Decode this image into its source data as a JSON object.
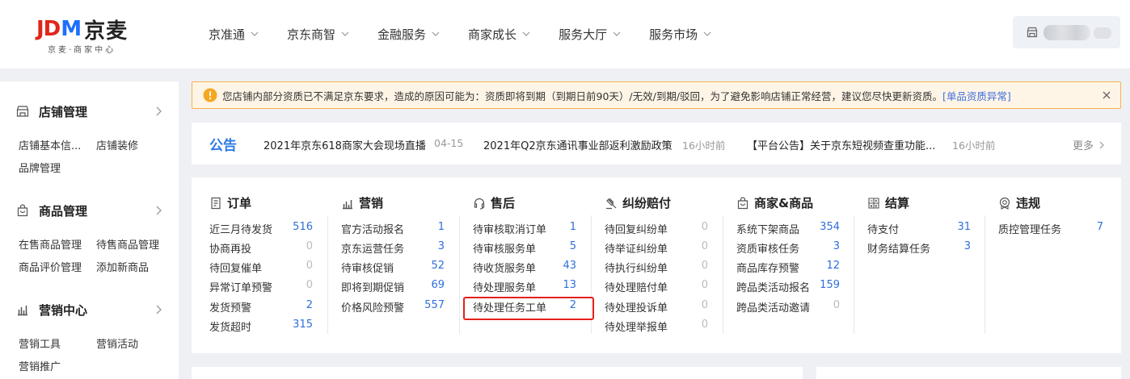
{
  "header": {
    "logo_jd": "JD",
    "logo_m": "M",
    "logo_cn": "京麦",
    "logo_sub": "京麦·商家中心",
    "nav": [
      {
        "label": "京准通"
      },
      {
        "label": "京东商智"
      },
      {
        "label": "金融服务"
      },
      {
        "label": "商家成长"
      },
      {
        "label": "服务大厅"
      },
      {
        "label": "服务市场"
      }
    ]
  },
  "sidebar": {
    "groups": [
      {
        "title": "店铺管理",
        "icon": "store-icon",
        "links": [
          "店铺基本信...",
          "店铺装修",
          "品牌管理"
        ]
      },
      {
        "title": "商品管理",
        "icon": "shopping-bag-icon",
        "links": [
          "在售商品管理",
          "待售商品管理",
          "商品评价管理",
          "添加新商品"
        ]
      },
      {
        "title": "营销中心",
        "icon": "bar-chart-icon",
        "links": [
          "营销工具",
          "营销活动",
          "营销推广"
        ]
      }
    ]
  },
  "alert": {
    "message": "您店铺内部分资质已不满足京东要求，造成的原因可能为：资质即将到期（到期日前90天）/无效/到期/驳回，为了避免影响店铺正常经营，建议您尽快更新资质。",
    "link": "[单品资质异常]"
  },
  "notice": {
    "label": "公告",
    "items": [
      {
        "title": "2021年京东618商家大会现场直播",
        "time": "04-15"
      },
      {
        "title": "2021年Q2京东通讯事业部返利激励政策",
        "time": "16小时前"
      },
      {
        "title": "【平台公告】关于京东短视频查重功能...",
        "time": "16小时前"
      }
    ],
    "more": "更多"
  },
  "tasks": {
    "columns": [
      {
        "title": "订单",
        "icon": "document-icon",
        "rows": [
          {
            "label": "近三月待发货",
            "value": "516"
          },
          {
            "label": "协商再投",
            "value": "0"
          },
          {
            "label": "待回复催单",
            "value": "0"
          },
          {
            "label": "异常订单预警",
            "value": "0"
          },
          {
            "label": "发货预警",
            "value": "2"
          },
          {
            "label": "发货超时",
            "value": "315"
          }
        ]
      },
      {
        "title": "营销",
        "icon": "bar-chart-icon",
        "rows": [
          {
            "label": "官方活动报名",
            "value": "1"
          },
          {
            "label": "京东运营任务",
            "value": "3"
          },
          {
            "label": "待审核促销",
            "value": "52"
          },
          {
            "label": "即将到期促销",
            "value": "69"
          },
          {
            "label": "价格风险预警",
            "value": "557"
          }
        ]
      },
      {
        "title": "售后",
        "icon": "headset-icon",
        "rows": [
          {
            "label": "待审核取消订单",
            "value": "1"
          },
          {
            "label": "待审核服务单",
            "value": "5"
          },
          {
            "label": "待收货服务单",
            "value": "43"
          },
          {
            "label": "待处理服务单",
            "value": "13"
          },
          {
            "label": "待处理任务工单",
            "value": "2"
          }
        ]
      },
      {
        "title": "纠纷赔付",
        "icon": "gavel-icon",
        "rows": [
          {
            "label": "待回复纠纷单",
            "value": "0"
          },
          {
            "label": "待举证纠纷单",
            "value": "0"
          },
          {
            "label": "待执行纠纷单",
            "value": "0"
          },
          {
            "label": "待处理赔付单",
            "value": "0"
          },
          {
            "label": "待处理投诉单",
            "value": "0"
          },
          {
            "label": "待处理举报单",
            "value": "0"
          }
        ]
      },
      {
        "title": "商家&商品",
        "icon": "shop-bag-icon",
        "rows": [
          {
            "label": "系统下架商品",
            "value": "354"
          },
          {
            "label": "资质审核任务",
            "value": "3"
          },
          {
            "label": "商品库存预警",
            "value": "12"
          },
          {
            "label": "跨品类活动报名",
            "value": "159"
          },
          {
            "label": "跨品类活动邀请",
            "value": "0"
          }
        ]
      },
      {
        "title": "结算",
        "icon": "calculator-icon",
        "rows": [
          {
            "label": "待支付",
            "value": "31"
          },
          {
            "label": "财务结算任务",
            "value": "3"
          }
        ]
      },
      {
        "title": "违规",
        "icon": "badge-icon",
        "rows": [
          {
            "label": "质控管理任务",
            "value": "7"
          }
        ]
      }
    ]
  }
}
